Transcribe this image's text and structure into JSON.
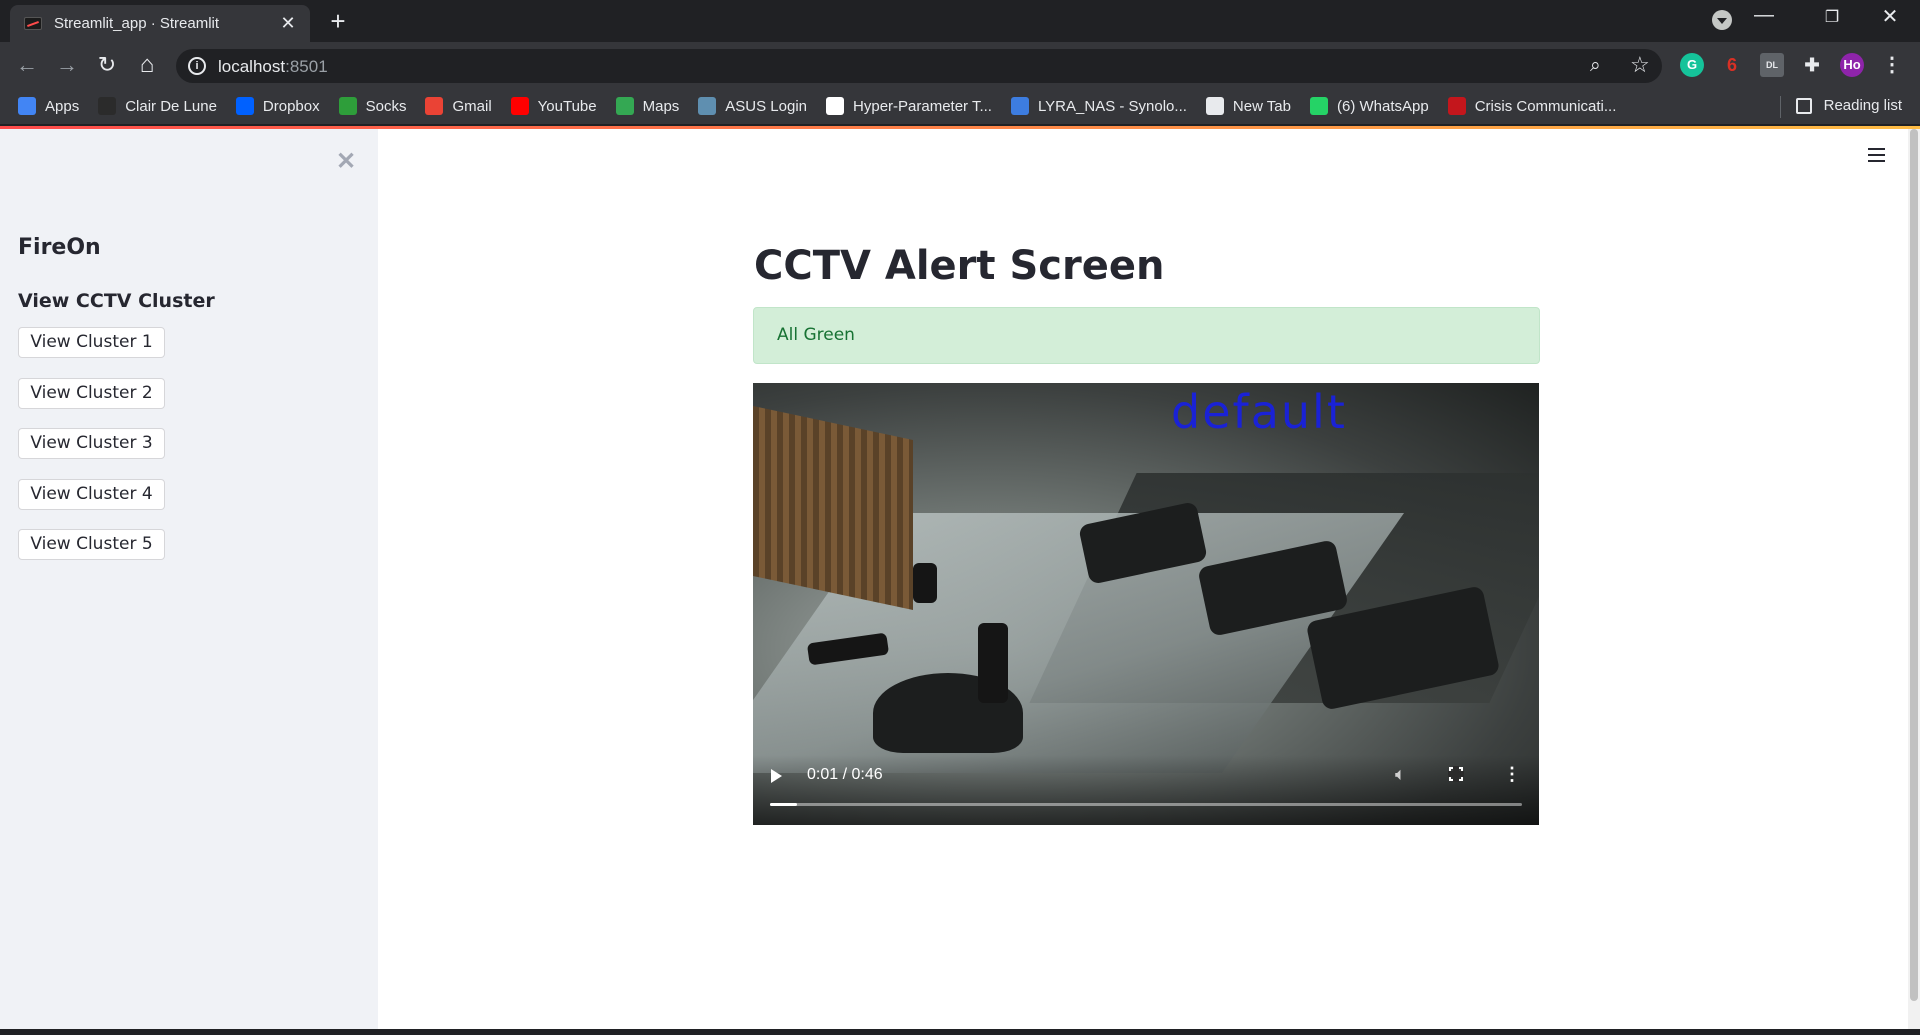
{
  "browser": {
    "tab_title": "Streamlit_app · Streamlit",
    "tab_close": "✕",
    "new_tab": "+",
    "url_host": "localhost",
    "url_port": ":8501",
    "profile_initials": "Ho",
    "window_controls": {
      "minimize": "—",
      "restore": "❐",
      "close": "✕"
    },
    "nav": {
      "back": "←",
      "forward": "→",
      "reload": "↻",
      "home": "⌂"
    }
  },
  "bookmarks": [
    {
      "label": "Apps",
      "icon": "apps-grid-icon",
      "color": "#4285f4"
    },
    {
      "label": "Clair De Lune",
      "icon": "clair-de-lune-icon",
      "color": "#2b2b2b"
    },
    {
      "label": "Dropbox",
      "icon": "dropbox-icon",
      "color": "#0061ff"
    },
    {
      "label": "Socks",
      "icon": "socks-icon",
      "color": "#2e9e3a"
    },
    {
      "label": "Gmail",
      "icon": "gmail-icon",
      "color": "#ea4335"
    },
    {
      "label": "YouTube",
      "icon": "youtube-icon",
      "color": "#ff0000"
    },
    {
      "label": "Maps",
      "icon": "maps-icon",
      "color": "#34a853"
    },
    {
      "label": "ASUS Login",
      "icon": "asus-icon",
      "color": "#5f8fb0"
    },
    {
      "label": "Hyper-Parameter T...",
      "icon": "hyper-parameter-icon",
      "color": "#ffffff"
    },
    {
      "label": "LYRA_NAS - Synolo...",
      "icon": "synology-icon",
      "color": "#3d7de0"
    },
    {
      "label": "New Tab",
      "icon": "globe-icon",
      "color": "#e8eaed"
    },
    {
      "label": "(6) WhatsApp",
      "icon": "whatsapp-icon",
      "color": "#25d366"
    },
    {
      "label": "Crisis Communicati...",
      "icon": "hbr-icon",
      "color": "#c4161c"
    }
  ],
  "reading_list": "Reading list",
  "sidebar": {
    "close": "✕",
    "app_name": "FireOn",
    "section_heading": "View CCTV Cluster",
    "buttons": [
      "View Cluster 1",
      "View Cluster 2",
      "View Cluster 3",
      "View Cluster 4",
      "View Cluster 5"
    ]
  },
  "main": {
    "title": "CCTV Alert Screen",
    "alert_text": "All Green",
    "alert_color": "#177233",
    "video": {
      "overlay_text": "default",
      "time_display": "0:01 / 0:46",
      "progress_fraction": 0.036
    }
  }
}
